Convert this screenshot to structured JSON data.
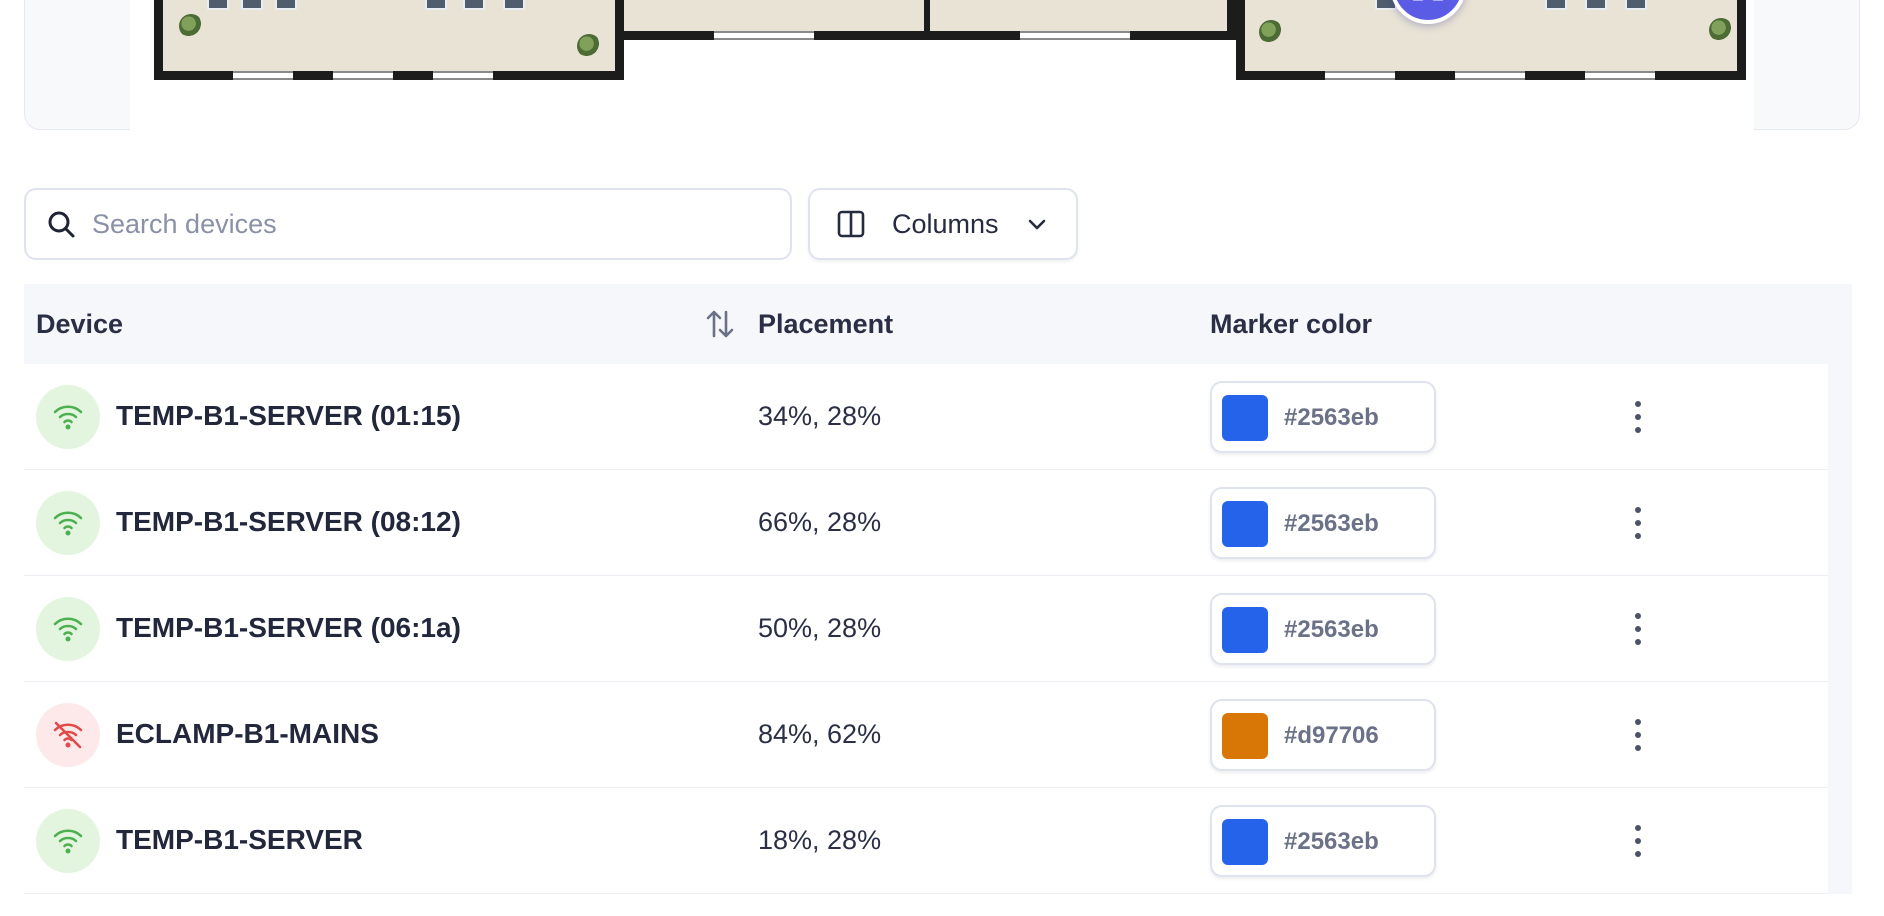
{
  "search": {
    "placeholder": "Search devices",
    "value": ""
  },
  "toolbar": {
    "columns_label": "Columns"
  },
  "table": {
    "headers": {
      "device": "Device",
      "placement": "Placement",
      "marker_color": "Marker color"
    },
    "rows": [
      {
        "name": "TEMP-B1-SERVER (01:15)",
        "status": "online",
        "placement": "34%, 28%",
        "color": "#2563eb"
      },
      {
        "name": "TEMP-B1-SERVER (08:12)",
        "status": "online",
        "placement": "66%, 28%",
        "color": "#2563eb"
      },
      {
        "name": "TEMP-B1-SERVER (06:1a)",
        "status": "online",
        "placement": "50%, 28%",
        "color": "#2563eb"
      },
      {
        "name": "ECLAMP-B1-MAINS",
        "status": "offline",
        "placement": "84%, 62%",
        "color": "#d97706"
      },
      {
        "name": "TEMP-B1-SERVER",
        "status": "online",
        "placement": "18%, 28%",
        "color": "#2563eb"
      }
    ]
  },
  "icons": {
    "search": "search-icon",
    "columns": "columns-icon",
    "chevron": "chevron-down-icon",
    "sort": "sort-icon",
    "online": "wifi-icon",
    "offline": "wifi-off-icon",
    "actions": "more-vertical-icon",
    "pin": "network-icon"
  },
  "colors": {
    "online_icon": "#4caf50",
    "offline_icon": "#e04a4a",
    "pin": "#5b5ce6"
  }
}
